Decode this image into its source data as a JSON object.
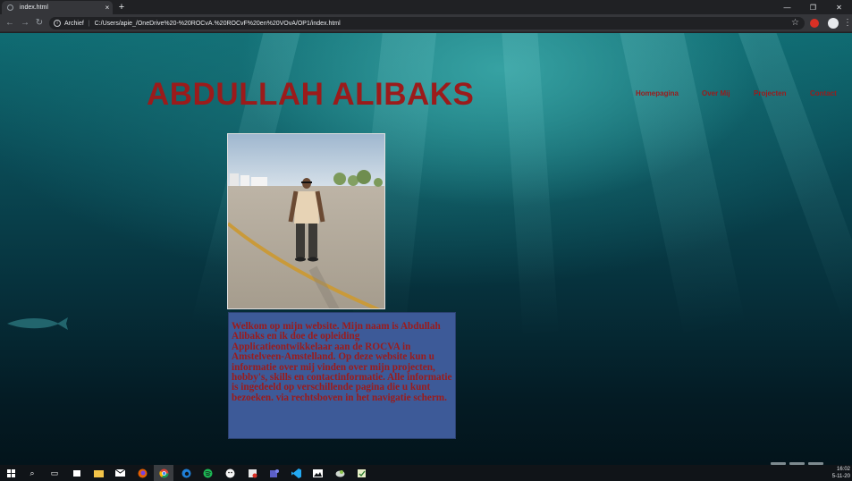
{
  "browser": {
    "tab_title": "index.html",
    "new_tab": "+",
    "close_tab": "×",
    "window_minimize": "—",
    "window_restore": "❐",
    "window_close": "✕",
    "back": "←",
    "forward": "→",
    "reload": "↻",
    "address_chip": "Archief",
    "address_sep": "|",
    "address_url": "C:/Users/apie_/OneDrive%20-%20ROCvA.%20ROCvF%20en%20VOvA/OP1/index.html",
    "star": "☆",
    "menu": "⋮"
  },
  "site": {
    "title": "ABDULLAH ALIBAKS",
    "nav": [
      "Homepagina",
      "Over Mij",
      "Projecten",
      "Contact"
    ],
    "intro": "Welkom op mijn website. Mijn naam is Abdullah Alibaks en ik doe de opleiding Applicatieontwikkelaar aan de ROCVA in Amstelveen-Amstelland. Op deze website kun u informatie over mij vinden over mijn projecten, hobby's, skills en contactinformatie. Alle informatie is ingedeeld op verschillende pagina die u kunt bezoeken. via rechtsboven in het navigatie scherm."
  },
  "colors": {
    "title_red": "#9b1b1b",
    "intro_bg": "#3d5a98",
    "water_dark": "#041b24",
    "water_light": "#0f6b72"
  },
  "taskbar": {
    "icons": [
      "windows-start-icon",
      "search-icon",
      "task-view-icon",
      "store-icon",
      "file-explorer-icon",
      "mail-icon",
      "firefox-icon",
      "chrome-icon",
      "edge-icon",
      "spotify-icon",
      "app-icon",
      "app-icon-2",
      "teams-icon",
      "vscode-icon",
      "photos-icon",
      "app-icon-3",
      "app-icon-4"
    ],
    "time": "16:02",
    "date": "5-11-20"
  }
}
